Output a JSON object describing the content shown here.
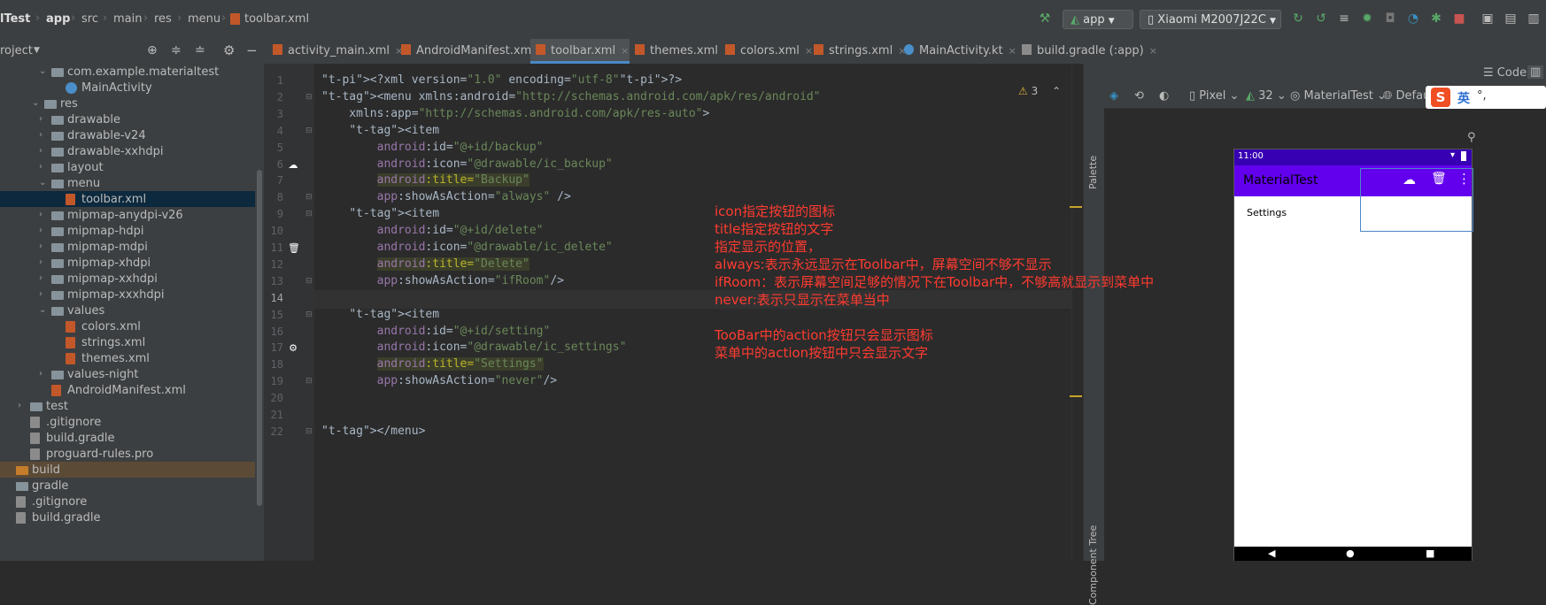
{
  "breadcrumb": {
    "project": "lTest",
    "items": [
      "app",
      "src",
      "main",
      "res",
      "menu"
    ],
    "file": "toolbar.xml"
  },
  "toolbar": {
    "run_config": "app",
    "device": "Xiaomi M2007J22C"
  },
  "project_panel": {
    "title": "roject"
  },
  "tree": [
    {
      "label": "com.example.materialtest",
      "indent": 5,
      "type": "folder",
      "arrow": "down"
    },
    {
      "label": "MainActivity",
      "indent": 7,
      "type": "kt",
      "arrow": ""
    },
    {
      "label": "res",
      "indent": 4,
      "type": "folder",
      "arrow": "down"
    },
    {
      "label": "drawable",
      "indent": 5,
      "type": "folder",
      "arrow": "right"
    },
    {
      "label": "drawable-v24",
      "indent": 5,
      "type": "folder",
      "arrow": "right"
    },
    {
      "label": "drawable-xxhdpi",
      "indent": 5,
      "type": "folder",
      "arrow": "right"
    },
    {
      "label": "layout",
      "indent": 5,
      "type": "folder",
      "arrow": "right"
    },
    {
      "label": "menu",
      "indent": 5,
      "type": "folder",
      "arrow": "down"
    },
    {
      "label": "toolbar.xml",
      "indent": 7,
      "type": "xml",
      "arrow": "",
      "selected": true
    },
    {
      "label": "mipmap-anydpi-v26",
      "indent": 5,
      "type": "folder",
      "arrow": "right"
    },
    {
      "label": "mipmap-hdpi",
      "indent": 5,
      "type": "folder",
      "arrow": "right"
    },
    {
      "label": "mipmap-mdpi",
      "indent": 5,
      "type": "folder",
      "arrow": "right"
    },
    {
      "label": "mipmap-xhdpi",
      "indent": 5,
      "type": "folder",
      "arrow": "right"
    },
    {
      "label": "mipmap-xxhdpi",
      "indent": 5,
      "type": "folder",
      "arrow": "right"
    },
    {
      "label": "mipmap-xxxhdpi",
      "indent": 5,
      "type": "folder",
      "arrow": "right"
    },
    {
      "label": "values",
      "indent": 5,
      "type": "folder",
      "arrow": "down"
    },
    {
      "label": "colors.xml",
      "indent": 7,
      "type": "xml",
      "arrow": ""
    },
    {
      "label": "strings.xml",
      "indent": 7,
      "type": "xml",
      "arrow": ""
    },
    {
      "label": "themes.xml",
      "indent": 7,
      "type": "xml",
      "arrow": ""
    },
    {
      "label": "values-night",
      "indent": 5,
      "type": "folder",
      "arrow": "right"
    },
    {
      "label": "AndroidManifest.xml",
      "indent": 5,
      "type": "manifest",
      "arrow": ""
    },
    {
      "label": "test",
      "indent": 2,
      "type": "folder",
      "arrow": "right"
    },
    {
      "label": ".gitignore",
      "indent": 2,
      "type": "misc",
      "arrow": ""
    },
    {
      "label": "build.gradle",
      "indent": 2,
      "type": "misc",
      "arrow": ""
    },
    {
      "label": "proguard-rules.pro",
      "indent": 2,
      "type": "misc",
      "arrow": ""
    },
    {
      "label": "build",
      "indent": 0,
      "type": "folder-orange",
      "arrow": "",
      "hl": true
    },
    {
      "label": "gradle",
      "indent": 0,
      "type": "folder",
      "arrow": ""
    },
    {
      "label": ".gitignore",
      "indent": 0,
      "type": "misc",
      "arrow": ""
    },
    {
      "label": "build.gradle",
      "indent": 0,
      "type": "misc",
      "arrow": ""
    }
  ],
  "tabs": [
    {
      "label": "activity_main.xml",
      "active": false
    },
    {
      "label": "AndroidManifest.xml",
      "active": false
    },
    {
      "label": "toolbar.xml",
      "active": true
    },
    {
      "label": "themes.xml",
      "active": false
    },
    {
      "label": "colors.xml",
      "active": false
    },
    {
      "label": "strings.xml",
      "active": false
    },
    {
      "label": "MainActivity.kt",
      "active": false
    },
    {
      "label": "build.gradle (:app)",
      "active": false
    }
  ],
  "editor": {
    "current_line": 14,
    "warning_count": "3",
    "lines": [
      "<?xml version=\"1.0\" encoding=\"utf-8\"?>",
      "<menu xmlns:android=\"http://schemas.android.com/apk/res/android\"",
      "    xmlns:app=\"http://schemas.android.com/apk/res-auto\">",
      "    <item",
      "        android:id=\"@+id/backup\"",
      "        android:icon=\"@drawable/ic_backup\"",
      "        android:title=\"Backup\"",
      "        app:showAsAction=\"always\" />",
      "    <item",
      "        android:id=\"@+id/delete\"",
      "        android:icon=\"@drawable/ic_delete\"",
      "        android:title=\"Delete\"",
      "        app:showAsAction=\"ifRoom\"/>",
      "",
      "    <item",
      "        android:id=\"@+id/setting\"",
      "        android:icon=\"@drawable/ic_settings\"",
      "        android:title=\"Settings\"",
      "        app:showAsAction=\"never\"/>",
      "",
      "",
      "</menu>"
    ]
  },
  "annotations": [
    "icon指定按钮的图标",
    "title指定按钮的文字",
    "指定显示的位置，",
    "always:表示永远显示在Toolbar中，屏幕空间不够不显示",
    "ifRoom：表示屏幕空间足够的情况下在Toolbar中，不够高就显示到菜单中",
    "never:表示只显示在菜单当中",
    "",
    "TooBar中的action按钮只会显示图标",
    "菜单中的action按钮中只会显示文字"
  ],
  "side_strip": {
    "palette": "Palette",
    "component_tree": "Component Tree"
  },
  "design": {
    "code_label": "Code",
    "device": "Pixel",
    "api": "32",
    "theme": "MaterialTest",
    "locale": "Default (",
    "ime_label": "英",
    "ime_extra": "°,",
    "phone": {
      "time": "11:00",
      "app_title": "MaterialTest",
      "menu_item": "Settings",
      "appbar_color": "#6200ee",
      "statusbar_color": "#3700b3"
    }
  },
  "colors": {
    "annotation": "#ff3b30",
    "accent": "#4a88c7"
  }
}
